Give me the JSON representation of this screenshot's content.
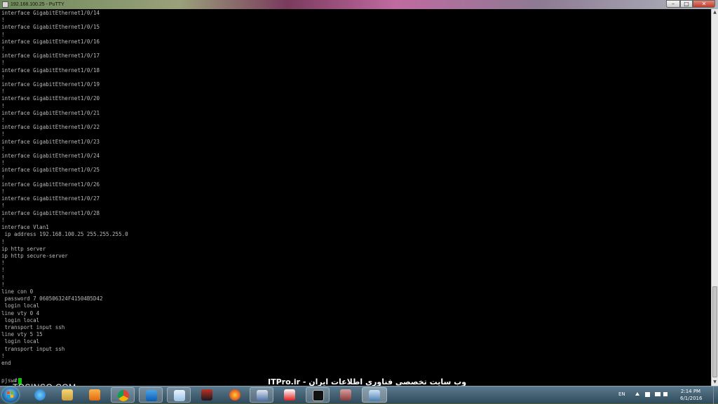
{
  "window": {
    "title": "192.168.100.25 - PuTTY",
    "minimize_glyph": "–",
    "maximize_glyph": "□",
    "close_glyph": "✕"
  },
  "terminal": {
    "lines": [
      "interface GigabitEthernet1/0/14",
      "!",
      "interface GigabitEthernet1/0/15",
      "!",
      "interface GigabitEthernet1/0/16",
      "!",
      "interface GigabitEthernet1/0/17",
      "!",
      "interface GigabitEthernet1/0/18",
      "!",
      "interface GigabitEthernet1/0/19",
      "!",
      "interface GigabitEthernet1/0/20",
      "!",
      "interface GigabitEthernet1/0/21",
      "!",
      "interface GigabitEthernet1/0/22",
      "!",
      "interface GigabitEthernet1/0/23",
      "!",
      "interface GigabitEthernet1/0/24",
      "!",
      "interface GigabitEthernet1/0/25",
      "!",
      "interface GigabitEthernet1/0/26",
      "!",
      "interface GigabitEthernet1/0/27",
      "!",
      "interface GigabitEthernet1/0/28",
      "!",
      "interface Vlan1",
      " ip address 192.168.100.25 255.255.255.0",
      "!",
      "ip http server",
      "ip http secure-server",
      "!",
      "!",
      "!",
      "!",
      "line con 0",
      " password 7 060506324F41504B5D42",
      " login local",
      "line vty 0 4",
      " login local",
      " transport input ssh",
      "line vty 5 15",
      " login local",
      " transport input ssh",
      "!",
      "end"
    ],
    "prompt": "pjsw#"
  },
  "overlay": {
    "left_watermark": "TOSINSO.COM",
    "right_watermark": "ITPro.ir - وب سایت تخصصی فناوری اطلاعات ایران"
  },
  "taskbar": {
    "language": "EN",
    "time": "2:14 PM",
    "date": "6/1/2016",
    "apps": [
      "windows-explorer",
      "internet-explorer",
      "file-manager",
      "media-player",
      "chrome",
      "outlook",
      "notepad",
      "kaspersky",
      "firefox",
      "network-tool",
      "pdf-reader",
      "command-prompt",
      "archive-tool",
      "putty"
    ],
    "active_app": "putty",
    "colors": {
      "terminal_bg": "#000000",
      "terminal_text": "#bbbbbb",
      "cursor": "#00cc00"
    }
  }
}
